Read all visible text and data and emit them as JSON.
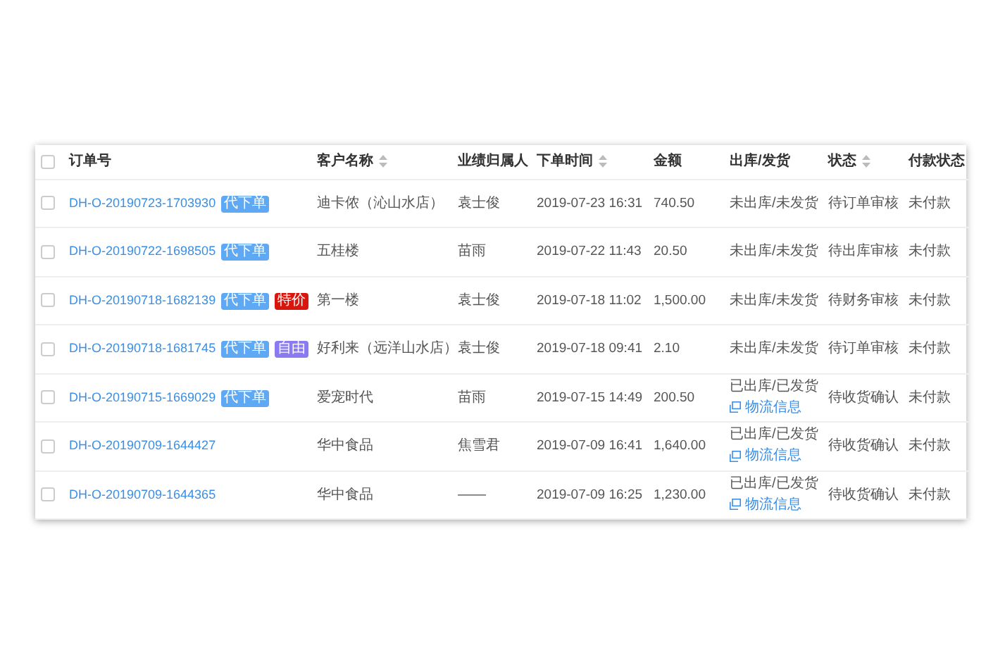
{
  "table": {
    "select_all": {
      "checked": false
    },
    "columns": [
      {
        "label": "订单号",
        "sortable": false
      },
      {
        "label": "客户名称",
        "sortable": true
      },
      {
        "label": "业绩归属人",
        "sortable": false
      },
      {
        "label": "下单时间",
        "sortable": true
      },
      {
        "label": "金额",
        "sortable": false
      },
      {
        "label": "出库/发货",
        "sortable": false
      },
      {
        "label": "状态",
        "sortable": true
      },
      {
        "label": "付款状态",
        "sortable": false
      }
    ],
    "rows": [
      {
        "checked": false,
        "order_no": "DH-O-20190723-1703930",
        "tags": [
          {
            "label": "代下单",
            "color": "#5ea8f4"
          }
        ],
        "customer": "迪卡侬（沁山水店）",
        "owner": "袁士俊",
        "time": "2019-07-23 16:31",
        "amount": "740.50",
        "shipping": "未出库/未发货",
        "status": "待订单审核",
        "payment": "未付款"
      },
      {
        "checked": false,
        "order_no": "DH-O-20190722-1698505",
        "tags": [
          {
            "label": "代下单",
            "color": "#5ea8f4"
          }
        ],
        "customer": "五桂楼",
        "owner": "苗雨",
        "time": "2019-07-22 11:43",
        "amount": "20.50",
        "shipping": "未出库/未发货",
        "status": "待出库审核",
        "payment": "未付款"
      },
      {
        "checked": false,
        "order_no": "DH-O-20190718-1682139",
        "tags": [
          {
            "label": "代下单",
            "color": "#5ea8f4"
          },
          {
            "label": "特价",
            "color": "#d8160d"
          }
        ],
        "customer": "第一楼",
        "owner": "袁士俊",
        "time": "2019-07-18 11:02",
        "amount": "1,500.00",
        "shipping": "未出库/未发货",
        "status": "待财务审核",
        "payment": "未付款"
      },
      {
        "checked": false,
        "order_no": "DH-O-20190718-1681745",
        "tags": [
          {
            "label": "代下单",
            "color": "#5ea8f4"
          },
          {
            "label": "自由",
            "color": "#8a7cf0"
          }
        ],
        "customer": "好利来（远洋山水店）",
        "owner": "袁士俊",
        "time": "2019-07-18 09:41",
        "amount": "2.10",
        "shipping": "未出库/未发货",
        "status": "待订单审核",
        "payment": "未付款"
      },
      {
        "checked": false,
        "order_no": "DH-O-20190715-1669029",
        "tags": [
          {
            "label": "代下单",
            "color": "#5ea8f4"
          }
        ],
        "customer": "爱宠时代",
        "owner": "苗雨",
        "time": "2019-07-15 14:49",
        "amount": "200.50",
        "shipping": "已出库/已发货",
        "logistics": "物流信息",
        "status": "待收货确认",
        "payment": "未付款"
      },
      {
        "checked": false,
        "order_no": "DH-O-20190709-1644427",
        "customer": "华中食品",
        "owner": "焦雪君",
        "time": "2019-07-09 16:41",
        "amount": "1,640.00",
        "shipping": "已出库/已发货",
        "logistics": "物流信息",
        "status": "待收货确认",
        "payment": "未付款"
      },
      {
        "checked": false,
        "order_no": "DH-O-20190709-1644365",
        "customer": "华中食品",
        "owner": "——",
        "time": "2019-07-09 16:25",
        "amount": "1,230.00",
        "shipping": "已出库/已发货",
        "logistics": "物流信息",
        "status": "待收货确认",
        "payment": "未付款"
      }
    ]
  }
}
